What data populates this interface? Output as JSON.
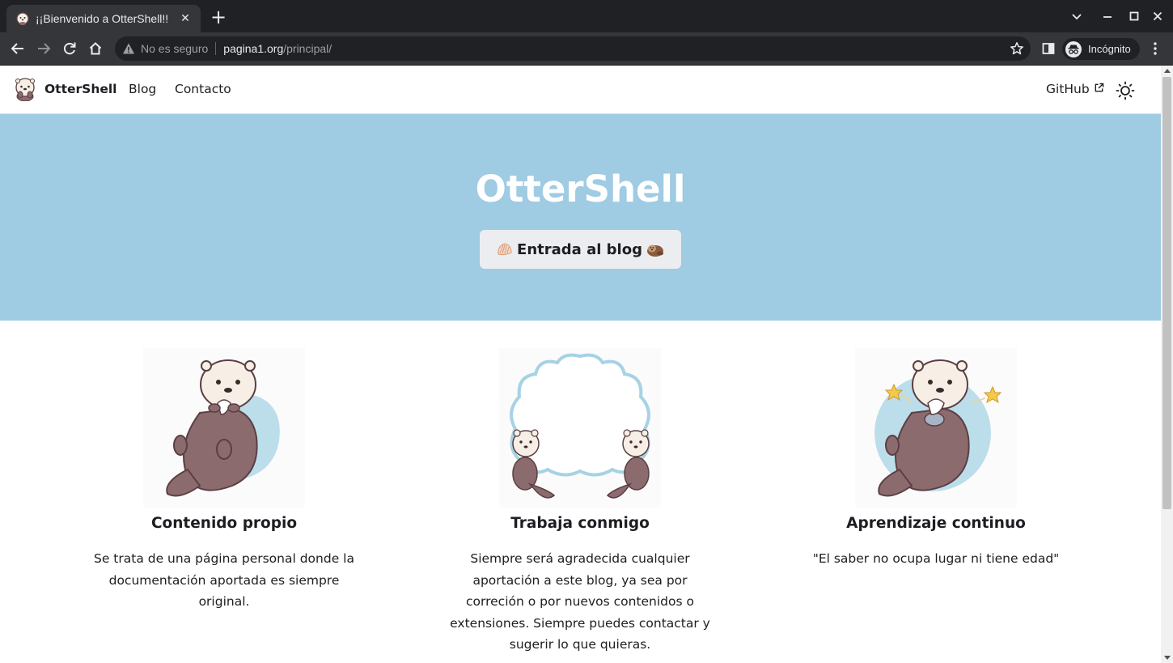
{
  "browser": {
    "tab_title": "¡¡Bienvenido a OtterShell!!",
    "security_label": "No es seguro",
    "url_host": "pagina1.org",
    "url_path": "/principal/",
    "profile_label": "Incógnito"
  },
  "nav": {
    "brand": "OtterShell",
    "links": [
      "Blog",
      "Contacto"
    ],
    "github": "GitHub"
  },
  "hero": {
    "title": "OtterShell",
    "button_label": "Entrada al blog"
  },
  "features": [
    {
      "title": "Contenido propio",
      "text": "Se trata de una página personal donde la documentación aportada es siempre original.",
      "image": "otter-holding-shell"
    },
    {
      "title": "Trabaja conmigo",
      "text": "Siempre será agradecida cualquier aportación a este blog, ya sea por correción o por nuevos contenidos o extensiones. Siempre puedes contactar y sugerir lo que quieras.",
      "image": "two-otters-cloud"
    },
    {
      "title": "Aprendizaje continuo",
      "text": "\"El saber no ocupa lugar ni tiene edad\"",
      "image": "otter-with-stars"
    }
  ],
  "colors": {
    "hero_bg": "#9fcbe3",
    "otter_brown": "#8c6b6f",
    "otter_face": "#f7efe6",
    "splash_blue": "#bcdeeb"
  }
}
